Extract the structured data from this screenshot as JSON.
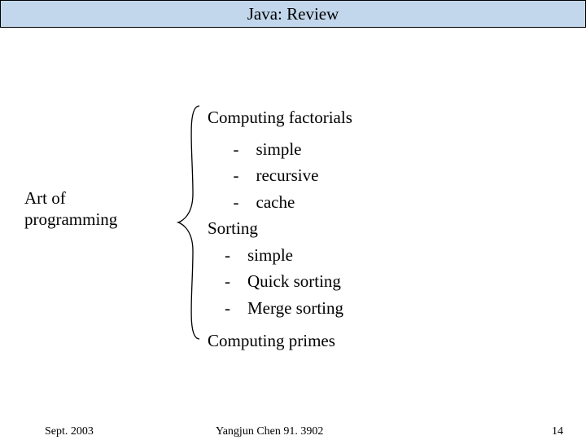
{
  "title": "Java: Review",
  "left_label_line1": "Art of",
  "left_label_line2": "programming",
  "content": {
    "heading_top": "Computing factorials",
    "items_top": [
      "-    simple",
      "-    recursive",
      "-    cache"
    ],
    "sorting_label": "Sorting",
    "sorting_items": [
      "-    simple",
      "-    Quick sorting",
      "-    Merge sorting"
    ],
    "heading_bottom": "Computing primes"
  },
  "footer": {
    "left": "Sept. 2003",
    "center": "Yangjun Chen       91. 3902",
    "right": "14"
  }
}
